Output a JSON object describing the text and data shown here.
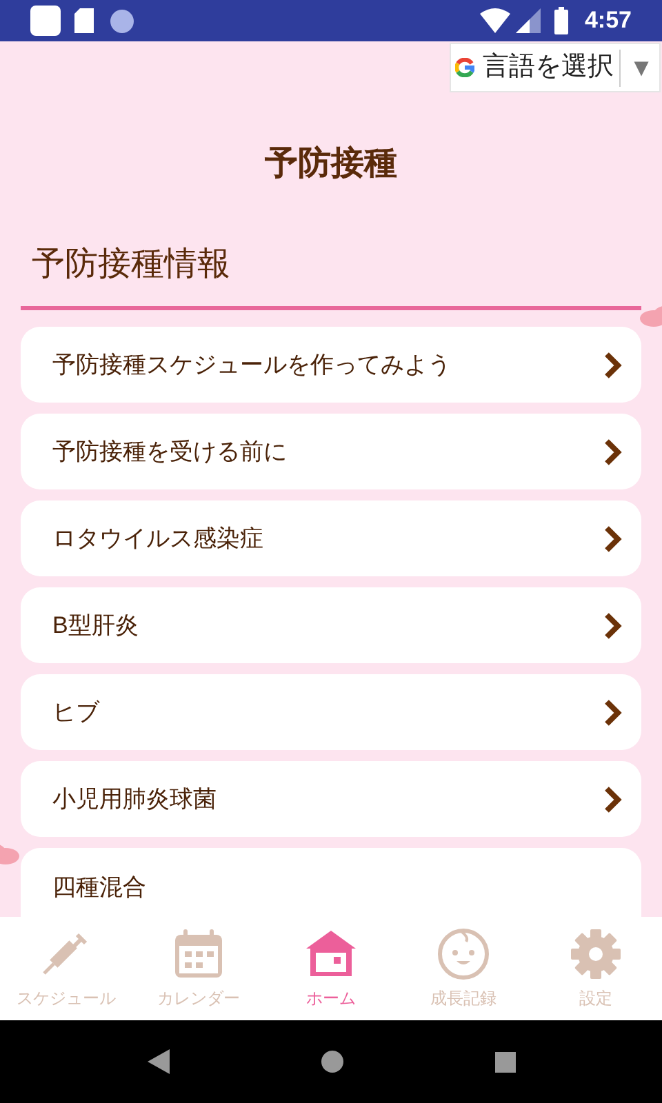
{
  "status_bar": {
    "time": "4:57"
  },
  "language_selector": {
    "label": "言語を選択",
    "arrow": "▼"
  },
  "page_title": "予防接種",
  "section_title": "予防接種情報",
  "items": [
    {
      "label": "予防接種スケジュールを作ってみよう"
    },
    {
      "label": "予防接種を受ける前に"
    },
    {
      "label": "ロタウイルス感染症"
    },
    {
      "label": "B型肝炎"
    },
    {
      "label": "ヒブ"
    },
    {
      "label": "小児用肺炎球菌"
    },
    {
      "label": "四種混合"
    }
  ],
  "bottom_nav": [
    {
      "kind": "syringe",
      "label": "スケジュール",
      "selected": false
    },
    {
      "kind": "calendar",
      "label": "カレンダー",
      "selected": false
    },
    {
      "kind": "home",
      "label": "ホーム",
      "selected": true
    },
    {
      "kind": "baby",
      "label": "成長記録",
      "selected": false
    },
    {
      "kind": "gear",
      "label": "設定",
      "selected": false
    }
  ]
}
